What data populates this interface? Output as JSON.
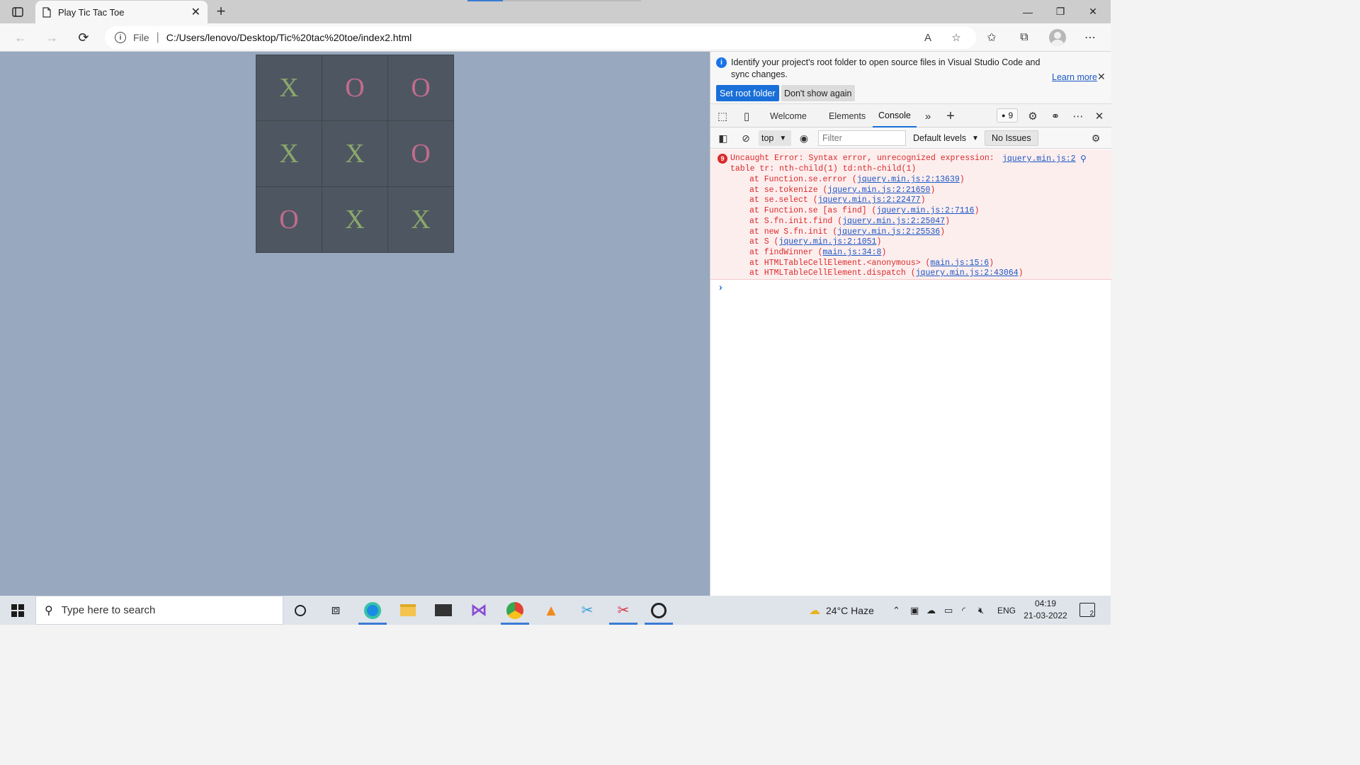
{
  "browser": {
    "tab_title": "Play Tic Tac Toe",
    "url_scheme": "File",
    "url": "C:/Users/lenovo/Desktop/Tic%20tac%20toe/index2.html"
  },
  "game": {
    "board": [
      [
        "X",
        "O",
        "O"
      ],
      [
        "X",
        "X",
        "O"
      ],
      [
        "O",
        "X",
        "X"
      ]
    ],
    "colors": {
      "x": "#8aa86b",
      "o": "#c36b8e",
      "board_bg": "#4e5761",
      "page_bg": "#97a8bf"
    }
  },
  "devtools": {
    "infobar": {
      "message": "Identify your project's root folder to open source files in Visual Studio Code and sync changes.",
      "learn_more": "Learn more",
      "set_root_folder": "Set root folder",
      "dont_show_again": "Don't show again"
    },
    "tabs": [
      "Welcome",
      "Elements",
      "Console"
    ],
    "active_tab": "Console",
    "issues_count": "9",
    "console_toolbar": {
      "context": "top",
      "filter_placeholder": "Filter",
      "levels": "Default levels",
      "no_issues": "No Issues"
    },
    "error": {
      "count": "9",
      "message_line1": "Uncaught Error: Syntax error, unrecognized expression:",
      "message_line2": "table tr: nth-child(1) td:nth-child(1)",
      "source": "jquery.min.js:2",
      "stack": [
        {
          "fn": "at Function.se.error (",
          "link": "jquery.min.js:2:13639",
          "end": ")"
        },
        {
          "fn": "at se.tokenize (",
          "link": "jquery.min.js:2:21650",
          "end": ")"
        },
        {
          "fn": "at se.select (",
          "link": "jquery.min.js:2:22477",
          "end": ")"
        },
        {
          "fn": "at Function.se [as find] (",
          "link": "jquery.min.js:2:7116",
          "end": ")"
        },
        {
          "fn": "at S.fn.init.find (",
          "link": "jquery.min.js:2:25047",
          "end": ")"
        },
        {
          "fn": "at new S.fn.init (",
          "link": "jquery.min.js:2:25536",
          "end": ")"
        },
        {
          "fn": "at S (",
          "link": "jquery.min.js:2:1051",
          "end": ")"
        },
        {
          "fn": "at findWinner (",
          "link": "main.js:34:8",
          "end": ")"
        },
        {
          "fn": "at HTMLTableCellElement.<anonymous> (",
          "link": "main.js:15:6",
          "end": ")"
        },
        {
          "fn": "at HTMLTableCellElement.dispatch (",
          "link": "jquery.min.js:2:43064",
          "end": ")"
        }
      ],
      "prompt": "›"
    }
  },
  "taskbar": {
    "search_placeholder": "Type here to search",
    "weather": "24°C  Haze",
    "language": "ENG",
    "time": "04:19",
    "date": "21-03-2022",
    "notifications": "2"
  }
}
